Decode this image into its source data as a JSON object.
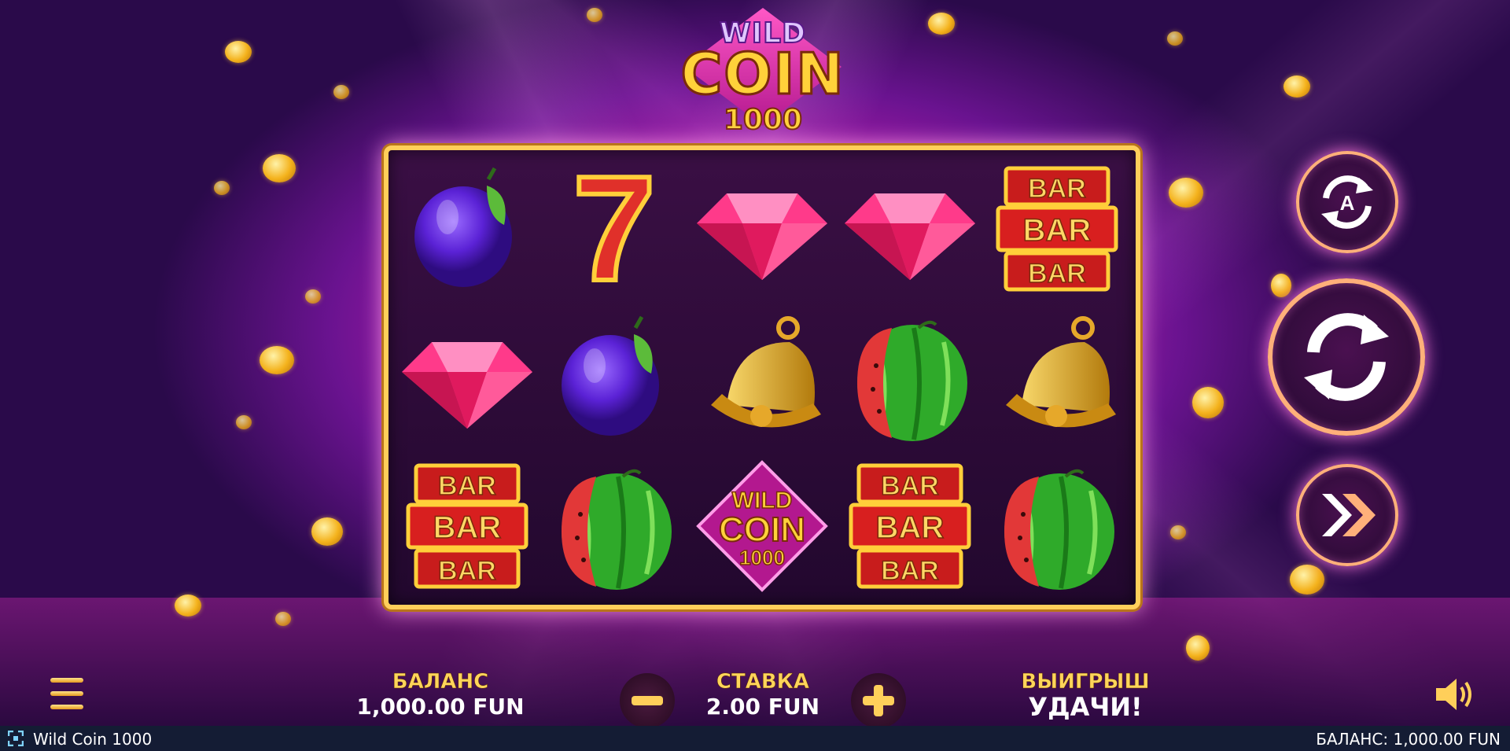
{
  "window": {
    "title": "Wild Coin 1000"
  },
  "logo": {
    "line1": "WILD",
    "line2": "COIN",
    "line3": "1000"
  },
  "reels": [
    [
      "plum",
      "seven",
      "diamond",
      "diamond",
      "bar"
    ],
    [
      "diamond",
      "plum",
      "bell",
      "watermelon",
      "bell"
    ],
    [
      "bar",
      "watermelon",
      "wild-coin",
      "bar",
      "watermelon"
    ]
  ],
  "symbols": {
    "bar_text": "BAR",
    "seven_text": "7",
    "wild_line1": "WILD",
    "wild_line2": "COIN",
    "wild_line3": "1000"
  },
  "panel": {
    "balance_label": "БАЛАНС",
    "balance_value": "1,000.00 FUN",
    "bet_label": "СТАВКА",
    "bet_value": "2.00 FUN",
    "win_label": "ВЫИГРЫШ",
    "win_value": "УДАЧИ!"
  },
  "controls": {
    "autoplay_letter": "A",
    "minus": "−",
    "plus": "+"
  },
  "statusbar": {
    "title": "Wild Coin 1000",
    "balance": "БАЛАНС: 1,000.00 FUN"
  },
  "colors": {
    "accent_gold": "#ffd23a",
    "frame_gold": "#ffcf5a",
    "bg_magenta": "#c21fb0",
    "statusbar_bg": "#141c34"
  }
}
